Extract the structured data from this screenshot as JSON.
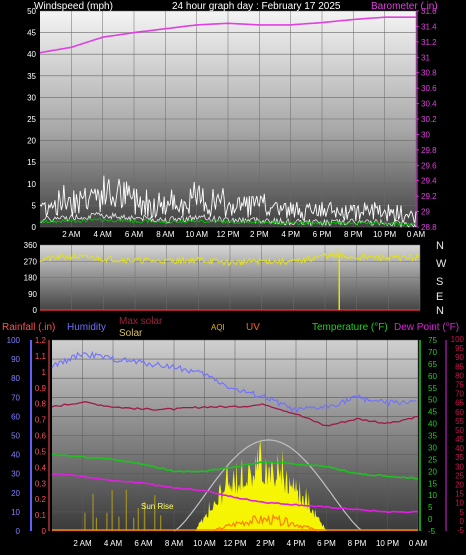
{
  "header": {
    "wind_label": "Windspeed (mph)",
    "title": "24 hour graph day : February 17 2025",
    "baro_label": "Barometer (.in)"
  },
  "bottom_legend": {
    "rainfall": "Rainfall (.in)",
    "humidity": "Humidity",
    "max_solar": "Max solar",
    "solar": "Solar",
    "aqi": "AQI",
    "uv": "UV",
    "temperature": "Temperature (°F)",
    "dew_point": "Dew Point (°F)",
    "sunrise": "Sun Rise"
  },
  "compass": [
    "N",
    "W",
    "S",
    "E",
    "N"
  ],
  "colors": {
    "wind": "#ffffff",
    "gust": "#00c800",
    "barometer": "#e040e0",
    "direction": "#e0e020",
    "rain": "#ff5050",
    "humidity": "#7070ff",
    "max_solar": "#c0c0c0",
    "solar": "#ffff00",
    "uv": "#ff8000",
    "temperature": "#20c020",
    "dewpoint": "#e020e0",
    "temp_high_line": "#a01848"
  },
  "x_ticks": [
    "2 AM",
    "4 AM",
    "6 AM",
    "8 AM",
    "10 AM",
    "12 PM",
    "2 PM",
    "4 PM",
    "6 PM",
    "8 PM",
    "10 PM",
    "0 AM"
  ],
  "chart_data": [
    {
      "type": "line",
      "title": "24 hour graph day : February 17 2025",
      "ylabel": "Windspeed (mph)",
      "y2label": "Barometer (.in)",
      "ylim": [
        0,
        50
      ],
      "y2lim": [
        28.8,
        31.6
      ],
      "yticks": [
        "0",
        "5",
        "10",
        "15",
        "20",
        "25",
        "30",
        "35",
        "40",
        "45",
        "50"
      ],
      "y2ticks": [
        "28.8",
        "29",
        "29.2",
        "29.4",
        "29.6",
        "29.8",
        "30",
        "30.2",
        "30.4",
        "30.6",
        "30.8",
        "31",
        "31.2",
        "31.4",
        "31.6"
      ],
      "x_hours": [
        0,
        2,
        4,
        6,
        8,
        10,
        12,
        14,
        16,
        18,
        20,
        22,
        24
      ],
      "series": [
        {
          "name": "Windspeed (mph)",
          "values": [
            3,
            4,
            5,
            4,
            3,
            4,
            3,
            3,
            2,
            2,
            2,
            2,
            1
          ]
        },
        {
          "name": "Barometer (.in)",
          "values": [
            31.06,
            31.13,
            31.26,
            31.32,
            31.37,
            31.42,
            31.44,
            31.42,
            31.42,
            31.45,
            31.49,
            31.52,
            31.52
          ]
        }
      ],
      "grid": true
    },
    {
      "type": "line",
      "ylabel": "Wind direction",
      "ylim": [
        0,
        360
      ],
      "yticks": [
        "0",
        "90",
        "180",
        "270",
        "360"
      ],
      "x_hours": [
        0,
        2,
        4,
        6,
        8,
        10,
        12,
        14,
        16,
        18,
        20,
        22,
        24
      ],
      "series": [
        {
          "name": "Wind direction",
          "values": [
            280,
            295,
            285,
            275,
            272,
            278,
            262,
            272,
            266,
            300,
            292,
            288,
            292
          ]
        }
      ],
      "grid": true
    },
    {
      "type": "line",
      "ylabel": "Rainfall (.in)",
      "y1lim": [
        0,
        1.2
      ],
      "y1ticks": [
        "0",
        "0.1",
        "0.2",
        "0.3",
        "0.4",
        "0.5",
        "0.6",
        "0.7",
        "0.8",
        "0.9",
        "1",
        "1.1",
        "1.2"
      ],
      "humidity_lim": [
        0,
        100
      ],
      "humidity_ticks": [
        "0",
        "10",
        "20",
        "30",
        "40",
        "50",
        "60",
        "70",
        "80",
        "90",
        "100"
      ],
      "temp_lim": [
        -5,
        75
      ],
      "temp_ticks": [
        "-5",
        "0",
        "5",
        "10",
        "15",
        "20",
        "25",
        "30",
        "35",
        "40",
        "45",
        "50",
        "55",
        "60",
        "65",
        "70",
        "75"
      ],
      "dew_lim": [
        -5,
        100
      ],
      "dew_ticks": [
        "-5",
        "0",
        "5",
        "10",
        "15",
        "20",
        "25",
        "30",
        "35",
        "40",
        "45",
        "50",
        "55",
        "60",
        "65",
        "70",
        "75",
        "80",
        "85",
        "90",
        "95",
        "100"
      ],
      "x_hours": [
        0,
        2,
        4,
        6,
        8,
        10,
        12,
        14,
        16,
        18,
        20,
        22,
        24
      ],
      "series": [
        {
          "name": "Humidity",
          "values": [
            86,
            93,
            90,
            88,
            86,
            82,
            74,
            70,
            63,
            65,
            70,
            67,
            68
          ]
        },
        {
          "name": "Temperature (°F)",
          "values": [
            27,
            26,
            25,
            23,
            20,
            20,
            22,
            24,
            23,
            22,
            19,
            18,
            17
          ]
        },
        {
          "name": "Dew Point (°F)",
          "values": [
            19,
            18,
            16,
            15,
            13,
            12,
            9,
            7,
            6,
            5,
            4,
            3,
            3
          ]
        },
        {
          "name": "Max solar",
          "values": [
            0,
            0,
            0,
            0,
            0,
            20,
            45,
            50,
            30,
            0,
            0,
            0,
            0
          ]
        },
        {
          "name": "Solar",
          "values": [
            0,
            0,
            0,
            0,
            0,
            15,
            22,
            30,
            12,
            0,
            0,
            0,
            0
          ]
        },
        {
          "name": "UV",
          "values": [
            0,
            0,
            0,
            0,
            0,
            0.1,
            0.2,
            0.2,
            0,
            0,
            0,
            0,
            0
          ]
        }
      ],
      "grid": true
    }
  ]
}
